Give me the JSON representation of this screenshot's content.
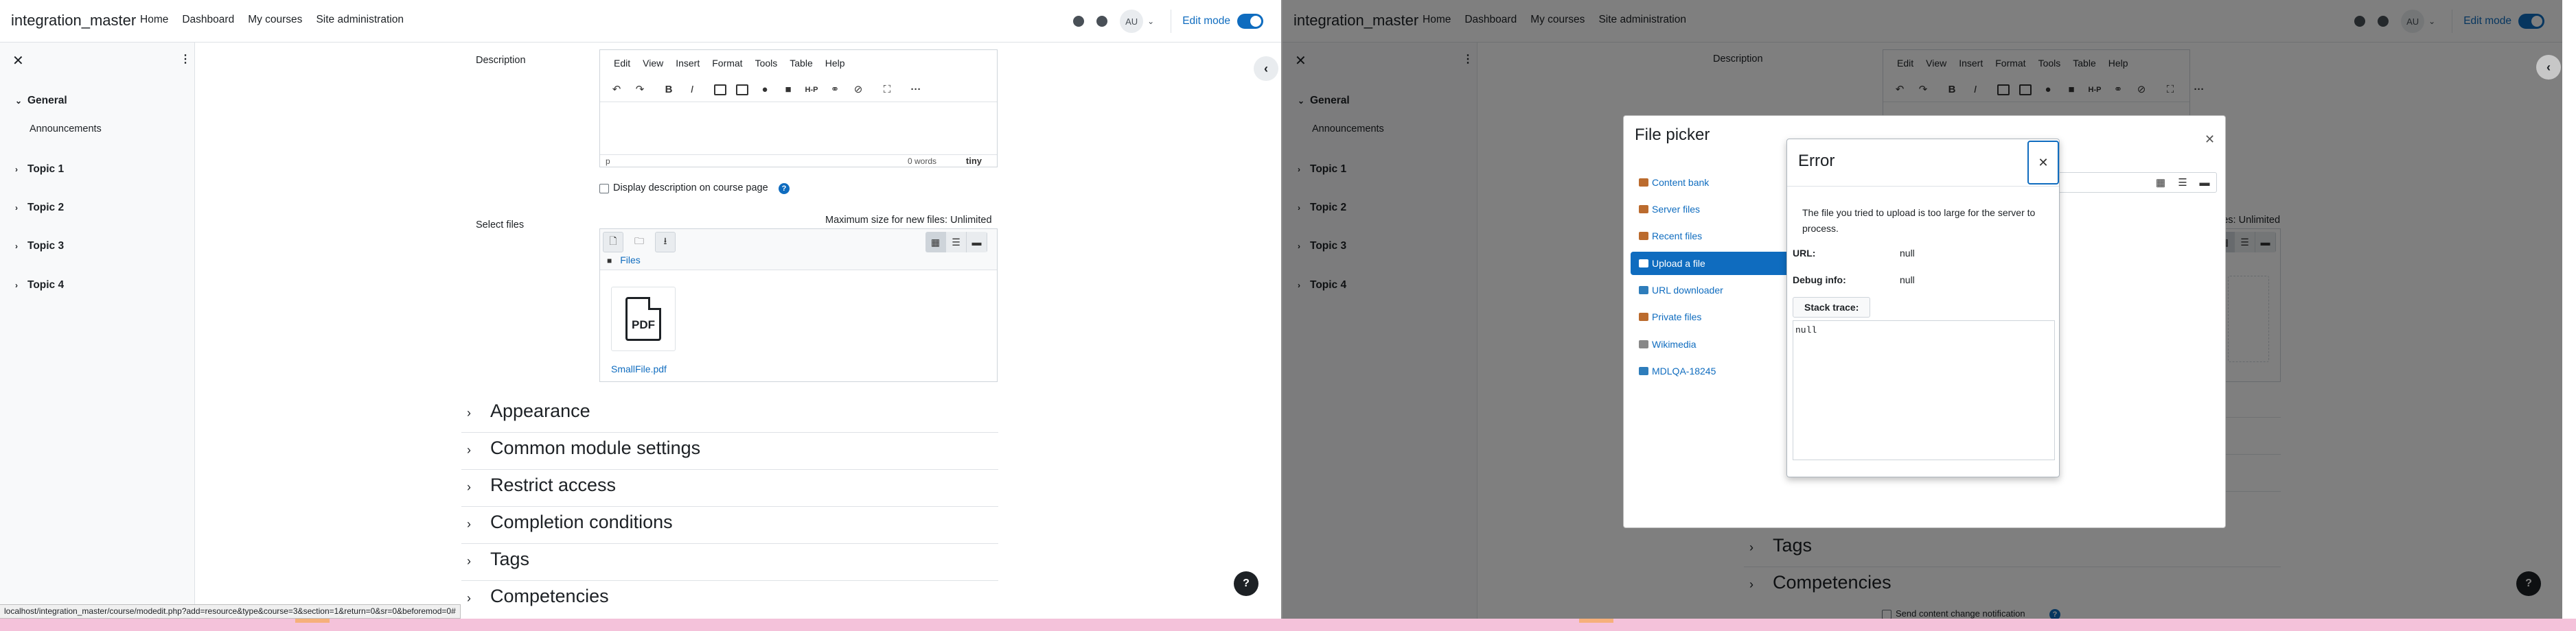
{
  "site_name": "integration_master",
  "nav": {
    "links": [
      "Home",
      "Dashboard",
      "My courses",
      "Site administration"
    ],
    "avatar": "AU",
    "edit_mode_label": "Edit mode"
  },
  "course_index": {
    "sections": [
      "General",
      "Topic 1",
      "Topic 2",
      "Topic 3",
      "Topic 4"
    ],
    "general_activity": "Announcements"
  },
  "form": {
    "description_label": "Description",
    "editor_menu": [
      "Edit",
      "View",
      "Insert",
      "Format",
      "Tools",
      "Table",
      "Help"
    ],
    "editor_status_path": "p",
    "editor_word_count": "0 words",
    "editor_brand": "tiny",
    "display_description_label": "Display description on course page",
    "select_files_label": "Select files",
    "max_size_text": "Maximum size for new files: Unlimited",
    "files_breadcrumb": "Files",
    "file_name": "SmallFile.pdf",
    "pdf_icon_text": "PDF",
    "collapsible_sections": [
      "Appearance",
      "Common module settings",
      "Restrict access",
      "Completion conditions",
      "Tags",
      "Competencies"
    ],
    "partial_text_right": "les: Unlimited",
    "send_notification_label": "Send content change notification"
  },
  "status_url": "localhost/integration_master/course/modedit.php?add=resource&type&course=3&section=1&return=0&sr=0&beforemod=0#",
  "file_picker": {
    "title": "File picker",
    "repositories": [
      "Content bank",
      "Server files",
      "Recent files",
      "Upload a file",
      "URL downloader",
      "Private files",
      "Wikimedia",
      "MDLQA-18245"
    ],
    "active_repository": "Upload a file"
  },
  "error_dialog": {
    "title": "Error",
    "message": "The file you tried to upload is too large for the server to process.",
    "url_label": "URL:",
    "url_value": "null",
    "debug_label": "Debug info:",
    "debug_value": "null",
    "stack_trace_label": "Stack trace:",
    "stack_trace_value": "null"
  },
  "icons": {
    "close": "✕",
    "kebab": "⋮",
    "caret_down": "⌄",
    "caret_right": "›",
    "chevron_left": "‹",
    "question": "?"
  },
  "colors": {
    "primary": "#0f6cbf",
    "text": "#1d2125",
    "pink_strip": "#f4c2da"
  }
}
